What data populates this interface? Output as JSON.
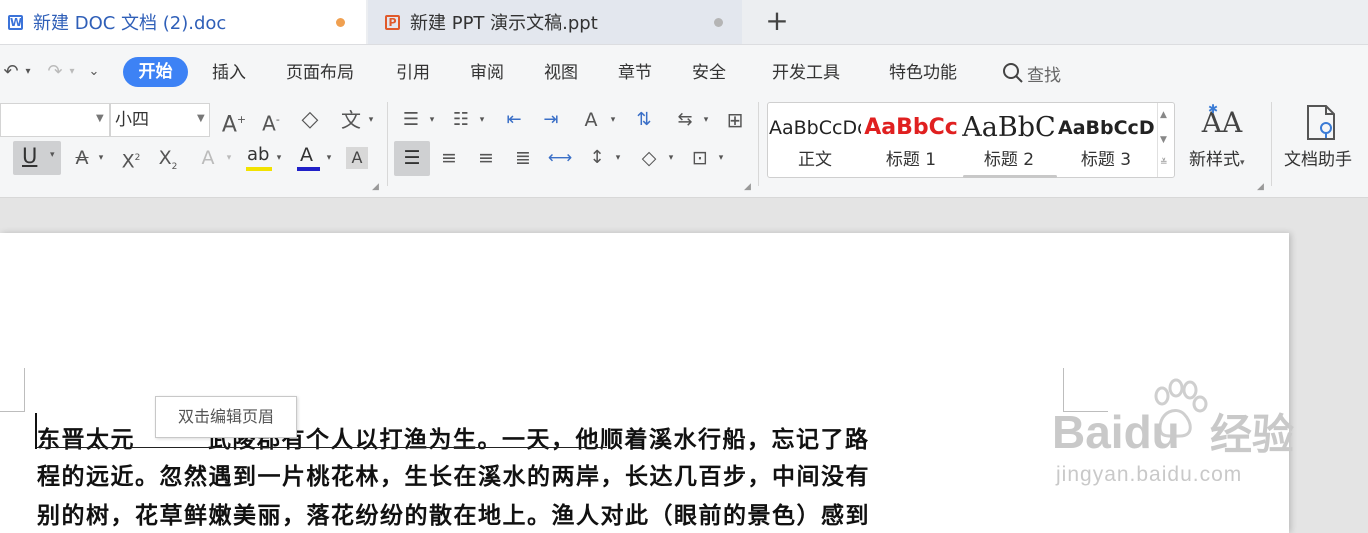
{
  "tabs": [
    {
      "title": "新建 DOC 文档 (2).doc",
      "icon": "word-doc-icon"
    },
    {
      "title": "新建 PPT 演示文稿.ppt",
      "icon": "ppt-icon"
    }
  ],
  "new_tab": "+",
  "menu": {
    "start": "开始",
    "items": [
      "插入",
      "页面布局",
      "引用",
      "审阅",
      "视图",
      "章节",
      "安全",
      "开发工具",
      "特色功能"
    ],
    "search": "查找"
  },
  "font": {
    "size": "小四"
  },
  "styles": [
    {
      "sample": "AaBbCcDd",
      "label": "正文"
    },
    {
      "sample": "AaBbCc",
      "label": "标题 1"
    },
    {
      "sample": "AaBbC",
      "label": "标题 2"
    },
    {
      "sample": "AaBbCcD",
      "label": "标题 3"
    }
  ],
  "new_style": "新样式",
  "doc_assistant": "文档助手",
  "tooltip": "双击编辑页眉",
  "document": {
    "line1a": "东晋太元",
    "line1b": "武陵郡有个人以打渔为生。一天，他顺着溪水行船，忘记了路",
    "line2": "程的远近。忽然遇到一片桃花林，生长在溪水的两岸，长达几百步，中间没有",
    "line3": "别的树，花草鲜嫩美丽，落花纷纷的散在地上。渔人对此（眼前的景色）感到"
  },
  "watermark": {
    "brand": "Baidu",
    "cn": "经验",
    "url": "jingyan.baidu.com"
  },
  "colors": {
    "accent": "#3d82f5",
    "heading1": "#e02020",
    "modified_dot": "#f0a050"
  }
}
